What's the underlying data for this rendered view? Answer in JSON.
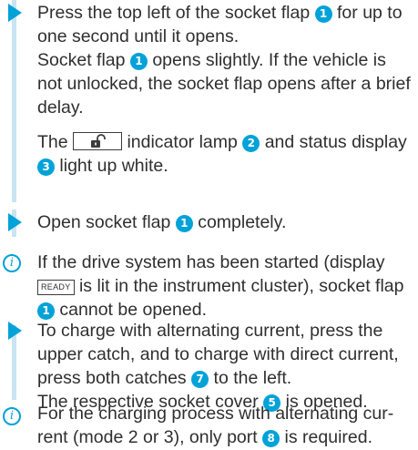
{
  "step1": {
    "main_a": "Press the top left of the socket flap",
    "main_b": "for up to one second until it opens.",
    "result_a": "Socket flap",
    "result_b": "opens slightly. If the vehicle is not unlocked, the socket flap opens after a brief delay.",
    "lamp_a": "The",
    "lamp_b": "indicator lamp",
    "lamp_c": "and status display",
    "lamp_d": "light up white."
  },
  "step2": {
    "a": "Open socket flap",
    "b": "completely."
  },
  "note1": {
    "a": "If the drive system has been started (display",
    "ready_label": "READY",
    "b": "is lit in the instrument cluster), socket flap",
    "c": "cannot be opened."
  },
  "step3": {
    "a": "To charge with alternating current, press the upper catch, and to charge with direct current, press both catches",
    "b": "to the left.",
    "c": "The respective socket cover",
    "d": "is opened."
  },
  "note2": {
    "a": "For the charging process with alternating cur-rent (mode 2 or 3), only port",
    "b": "is required."
  },
  "callouts": {
    "socket_flap": "1",
    "indicator_lamp": "2",
    "status_display": "3",
    "socket_cover": "5",
    "catches": "7",
    "port": "8"
  },
  "icons": {
    "step_marker": "triangle-right-icon",
    "note_marker": "info-icon",
    "indicator": "unlocked-padlock-icon"
  },
  "colors": {
    "accent": "#00a2d8",
    "bar": "#c9e4f2",
    "text": "#2f2f2f"
  }
}
